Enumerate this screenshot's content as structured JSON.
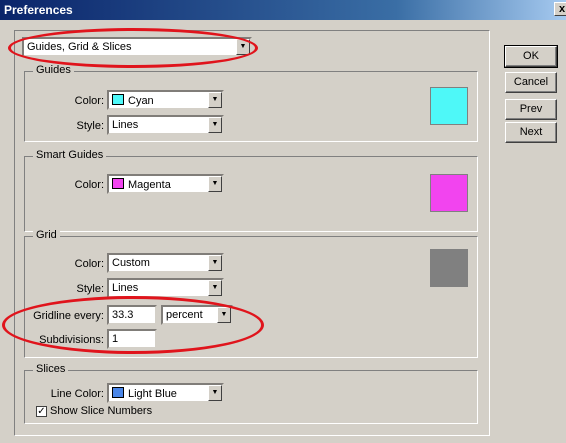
{
  "window": {
    "title": "Preferences",
    "close_label": "x"
  },
  "panel_select": {
    "value": "Guides, Grid & Slices"
  },
  "buttons": {
    "ok": "OK",
    "cancel": "Cancel",
    "prev": "Prev",
    "next": "Next"
  },
  "guides": {
    "title": "Guides",
    "color_label": "Color:",
    "color_value": "Cyan",
    "color_hex": "#4ef8f8",
    "style_label": "Style:",
    "style_value": "Lines"
  },
  "smart_guides": {
    "title": "Smart Guides",
    "color_label": "Color:",
    "color_value": "Magenta",
    "color_hex": "#f244ef"
  },
  "grid": {
    "title": "Grid",
    "color_label": "Color:",
    "color_value": "Custom",
    "color_hex": "#808080",
    "style_label": "Style:",
    "style_value": "Lines",
    "gridline_label": "Gridline every:",
    "gridline_value": "33.3",
    "unit_value": "percent",
    "subdivisions_label": "Subdivisions:",
    "subdivisions_value": "1"
  },
  "slices": {
    "title": "Slices",
    "line_color_label": "Line Color:",
    "line_color_value": "Light Blue",
    "line_color_hex": "#4a86e8",
    "show_numbers_label": "Show Slice Numbers",
    "show_numbers_checked": true
  },
  "colors": {
    "annotation": "#e0141c",
    "title_bar": "#0a246a"
  },
  "icons": {
    "dropdown": "chevron-down-icon",
    "check": "check-icon",
    "close": "close-icon"
  }
}
